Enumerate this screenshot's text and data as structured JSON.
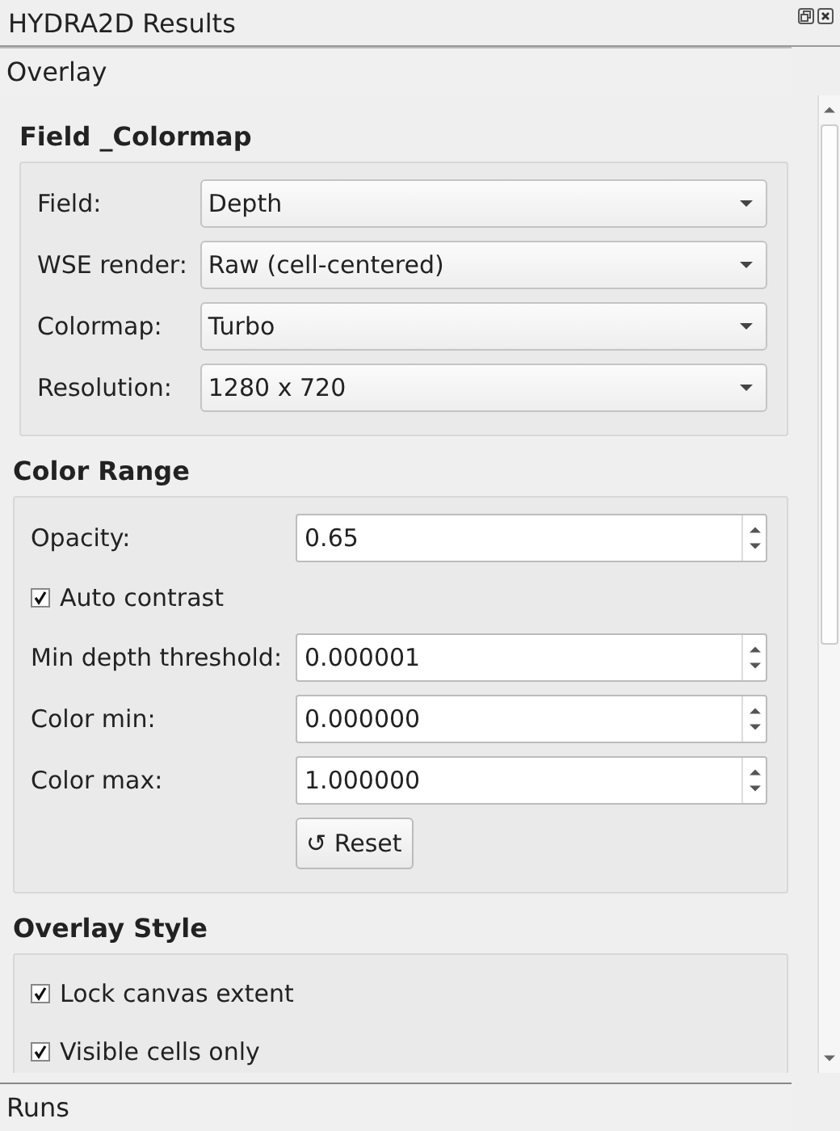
{
  "window": {
    "title": "HYDRA2D Results"
  },
  "pages": [
    {
      "label": "Overlay",
      "sections": [
        {
          "title": "Field _Colormap",
          "rows": [
            {
              "kind": "combo",
              "label": "Field:",
              "value": "Depth"
            },
            {
              "kind": "combo",
              "label": "WSE render:",
              "value": "Raw (cell-centered)"
            },
            {
              "kind": "combo",
              "label": "Colormap:",
              "value": "Turbo"
            },
            {
              "kind": "combo",
              "label": "Resolution:",
              "value": "1280 x 720"
            }
          ]
        },
        {
          "title": "Color Range",
          "rows": [
            {
              "kind": "spin",
              "label": "Opacity:",
              "value": "0.65"
            },
            {
              "kind": "check",
              "label": "Auto contrast",
              "checked": true
            },
            {
              "kind": "spin",
              "label": "Min depth threshold:",
              "value": "0.000001"
            },
            {
              "kind": "spin",
              "label": "Color min:",
              "value": "0.000000"
            },
            {
              "kind": "spin",
              "label": "Color max:",
              "value": "1.000000"
            },
            {
              "kind": "button",
              "label": "Reset",
              "icon": "↺"
            }
          ]
        },
        {
          "title": "Overlay Style",
          "rows": [
            {
              "kind": "check",
              "label": "Lock canvas extent",
              "checked": true
            },
            {
              "kind": "check",
              "label": "Visible cells only",
              "checked": true
            }
          ]
        }
      ]
    },
    {
      "label": "Runs"
    }
  ]
}
